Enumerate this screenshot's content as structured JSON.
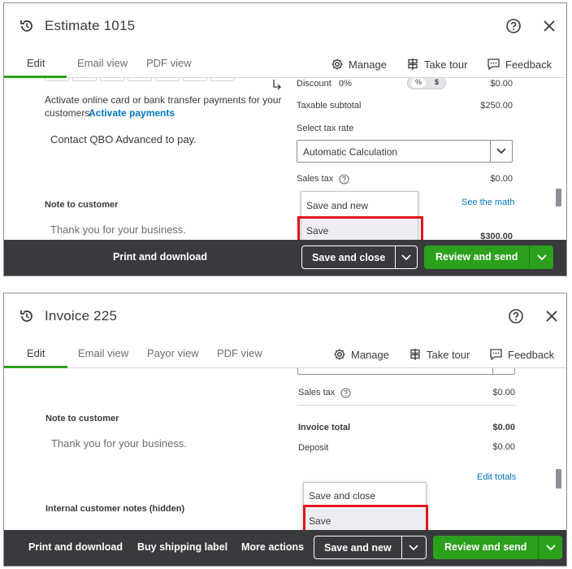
{
  "estimate": {
    "title": "Estimate 1015",
    "tabs": [
      {
        "label": "Edit",
        "active": true
      },
      {
        "label": "Email view"
      },
      {
        "label": "PDF view"
      }
    ],
    "toolbar": {
      "manage": "Manage",
      "tour": "Take tour",
      "feedback": "Feedback"
    },
    "left": {
      "payments_text_1": "Activate online card or bank transfer payments for your",
      "payments_text_2": "customers.",
      "activate_link": "Activate payments",
      "contact_text": "Contact QBO Advanced to pay.",
      "note_label": "Note to customer",
      "note_value": "Thank you for your business."
    },
    "right": {
      "discount_label": "Discount",
      "discount_value": "0%",
      "discount_toggle_pct": "%",
      "discount_toggle_dollar": "$",
      "discount_amount": "$0.00",
      "taxable_subtotal_label": "Taxable subtotal",
      "taxable_subtotal_value": "$250.00",
      "tax_rate_label": "Select tax rate",
      "tax_rate_value": "Automatic Calculation",
      "sales_tax_label": "Sales tax",
      "sales_tax_value": "$0.00",
      "see_math": "See the math",
      "total_value": "$300.00"
    },
    "dropdown": [
      {
        "label": "Save and new"
      },
      {
        "label": "Save",
        "highlighted": true
      }
    ],
    "footer": {
      "print": "Print and download",
      "save": "Save and close",
      "review": "Review and send"
    }
  },
  "invoice": {
    "title": "Invoice 225",
    "tabs": [
      {
        "label": "Edit",
        "active": true
      },
      {
        "label": "Email view"
      },
      {
        "label": "Payor view"
      },
      {
        "label": "PDF view"
      }
    ],
    "toolbar": {
      "manage": "Manage",
      "tour": "Take tour",
      "feedback": "Feedback"
    },
    "left": {
      "note_label": "Note to customer",
      "note_value": "Thank you for your business.",
      "internal_label": "Internal customer notes (hidden)"
    },
    "right": {
      "sales_tax_label": "Sales tax",
      "sales_tax_value": "$0.00",
      "invoice_total_label": "Invoice total",
      "invoice_total_value": "$0.00",
      "deposit_label": "Deposit",
      "deposit_value": "$0.00",
      "edit_totals": "Edit totals"
    },
    "dropdown": [
      {
        "label": "Save and close"
      },
      {
        "label": "Save",
        "highlighted": true
      }
    ],
    "footer": {
      "print": "Print and download",
      "shipping": "Buy shipping label",
      "more": "More actions",
      "save": "Save and new",
      "review": "Review and send"
    }
  },
  "colors": {
    "accent_green": "#2ca01c",
    "footer_bg": "#393a3d",
    "link_blue": "#0077c5",
    "highlight_red": "#e0141e"
  },
  "icons": {
    "history": "history-icon",
    "help": "help-circle-icon",
    "close": "close-icon",
    "gear": "gear-icon",
    "tour": "tour-icon",
    "feedback": "feedback-icon",
    "chevron": "chevron-down-icon",
    "info": "info-circle-icon"
  }
}
